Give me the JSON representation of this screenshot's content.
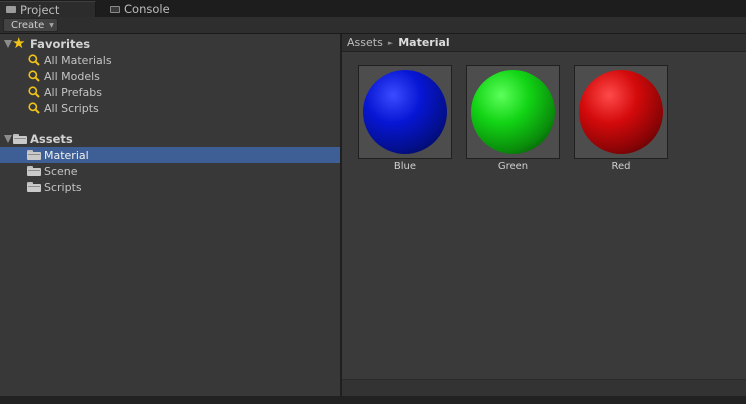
{
  "tabs": [
    {
      "label": "Project",
      "icon": "folder-icon",
      "active": true
    },
    {
      "label": "Console",
      "icon": "console-icon",
      "active": false
    }
  ],
  "toolbar": {
    "create_label": "Create",
    "create_arrow": "▼"
  },
  "favorites": {
    "header": "Favorites",
    "items": [
      {
        "label": "All Materials",
        "icon": "search-icon"
      },
      {
        "label": "All Models",
        "icon": "search-icon"
      },
      {
        "label": "All Prefabs",
        "icon": "search-icon"
      },
      {
        "label": "All Scripts",
        "icon": "search-icon"
      }
    ]
  },
  "assets_tree": {
    "header": "Assets",
    "items": [
      {
        "label": "Material",
        "selected": true
      },
      {
        "label": "Scene",
        "selected": false
      },
      {
        "label": "Scripts",
        "selected": false
      }
    ]
  },
  "breadcrumb": {
    "root": "Assets",
    "separator": "►",
    "current": "Material"
  },
  "assets": [
    {
      "name": "Blue",
      "color": "#0a16c8"
    },
    {
      "name": "Green",
      "color": "#10c816"
    },
    {
      "name": "Red",
      "color": "#c8080a"
    }
  ],
  "colors": {
    "selection": "#3e5f96",
    "favorites_star": "#f2c318",
    "search_icon": "#f2c318"
  }
}
